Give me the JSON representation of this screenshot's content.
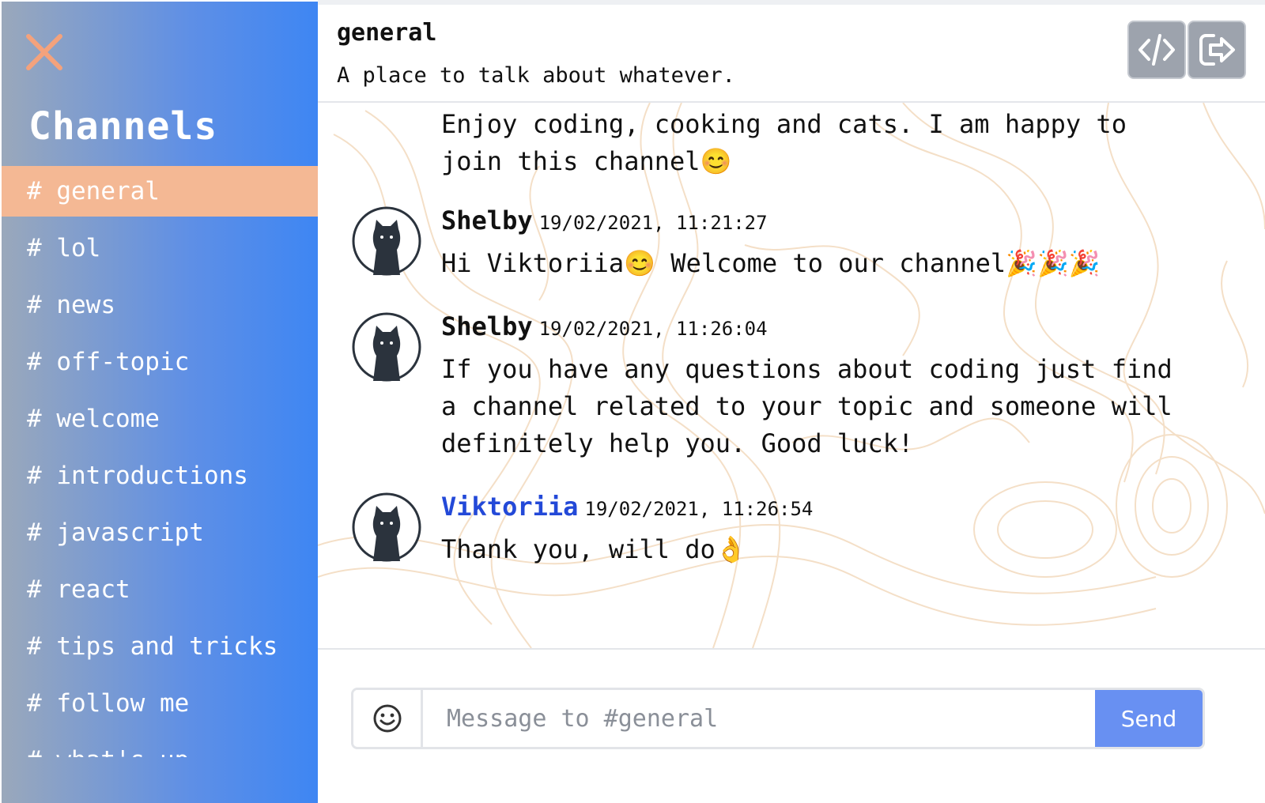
{
  "sidebar": {
    "title": "Channels",
    "channels": [
      {
        "label": "# general",
        "active": true
      },
      {
        "label": "# lol"
      },
      {
        "label": "# news"
      },
      {
        "label": "# off-topic"
      },
      {
        "label": "# welcome"
      },
      {
        "label": "# introductions"
      },
      {
        "label": "# javascript"
      },
      {
        "label": "# react"
      },
      {
        "label": "# tips and tricks"
      },
      {
        "label": "# follow me"
      },
      {
        "label": "# what's up"
      }
    ]
  },
  "header": {
    "channel_name": "general",
    "channel_description": "A place to talk about whatever."
  },
  "messages": [
    {
      "author": "",
      "timestamp": "",
      "text": "Enjoy coding, cooking and cats. I am happy to join this channel😊"
    },
    {
      "author": "Shelby",
      "timestamp": "19/02/2021, 11:21:27",
      "text": "Hi Viktoriia😊 Welcome to our channel🎉🎉🎉"
    },
    {
      "author": "Shelby",
      "timestamp": "19/02/2021, 11:26:04",
      "text": "If you have any questions about coding just find a channel related to your topic and someone will definitely help you. Good luck!"
    },
    {
      "author": "Viktoriia",
      "timestamp": "19/02/2021, 11:26:54",
      "text": "Thank you, will do👌"
    }
  ],
  "composer": {
    "placeholder": "Message to #general",
    "send_label": "Send"
  },
  "colors": {
    "sidebar_gradient_start": "#9aa8bb",
    "sidebar_gradient_end": "#3e86f3",
    "active_channel": "#f4b894",
    "close_icon": "#f4a27c",
    "self_author": "#2349d8",
    "send_button": "#6890f2"
  }
}
